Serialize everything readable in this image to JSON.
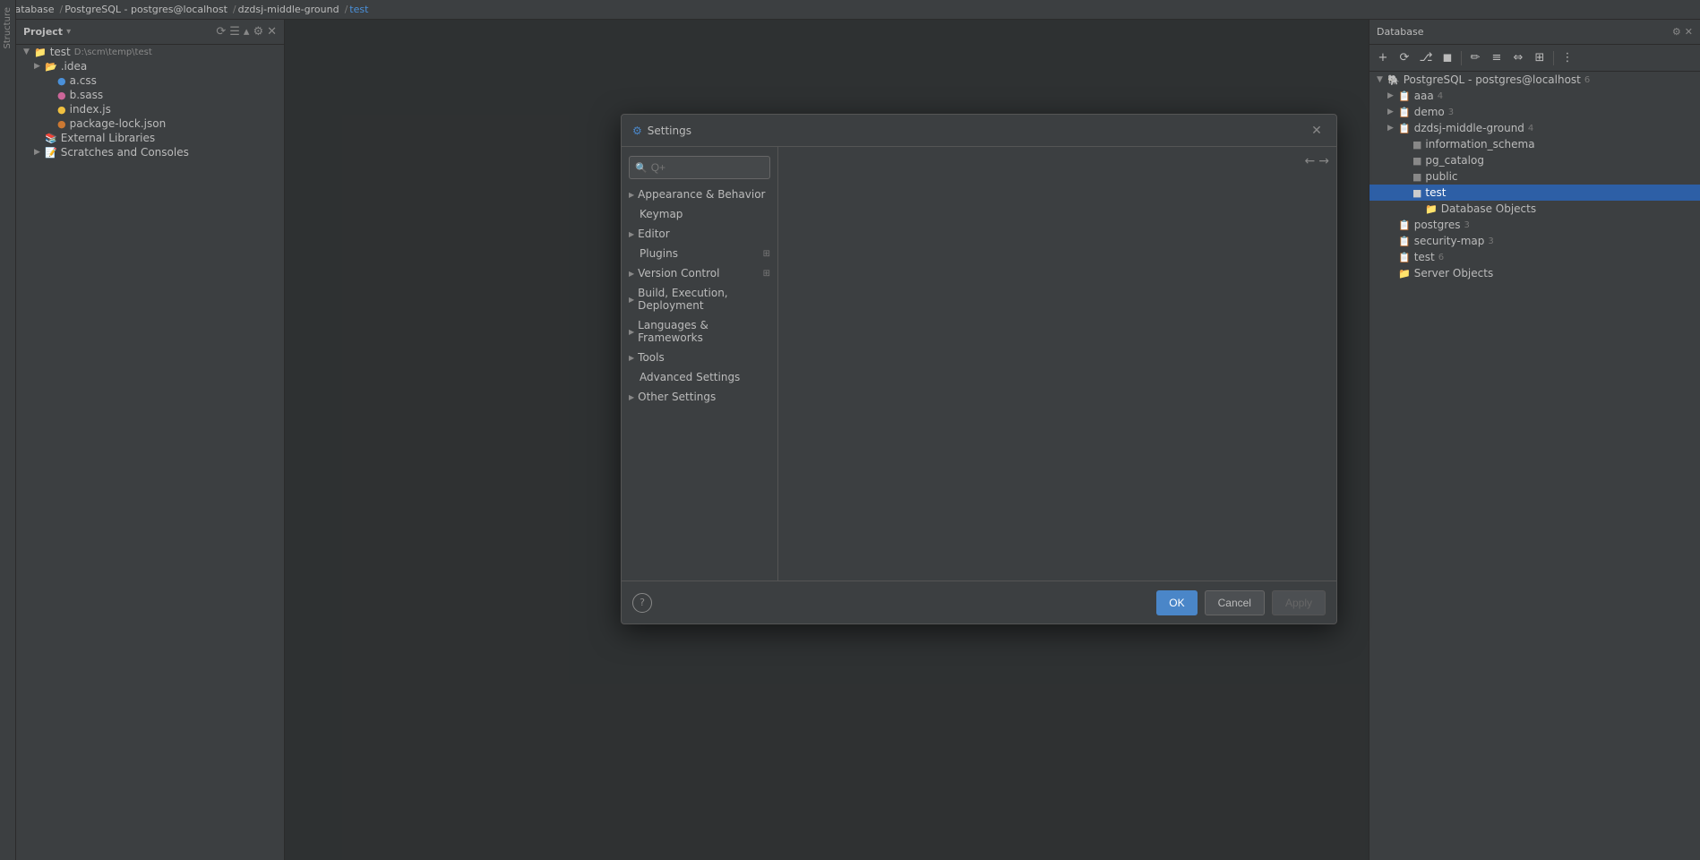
{
  "topbar": {
    "breadcrumbs": [
      "Database",
      "PostgreSQL - postgres@localhost",
      "dzdsj-middle-ground",
      "test"
    ],
    "separator": "/"
  },
  "project_panel": {
    "title": "Project",
    "root_item": "test",
    "root_path": "D:\\scm\\temp\\test",
    "items": [
      {
        "label": ".idea",
        "indent": 1,
        "type": "folder",
        "arrow": true
      },
      {
        "label": "a.css",
        "indent": 2,
        "type": "css"
      },
      {
        "label": "b.sass",
        "indent": 2,
        "type": "sass"
      },
      {
        "label": "index.js",
        "indent": 2,
        "type": "js"
      },
      {
        "label": "package-lock.json",
        "indent": 2,
        "type": "json"
      },
      {
        "label": "External Libraries",
        "indent": 1,
        "type": "folder",
        "arrow": false
      },
      {
        "label": "Scratches and Consoles",
        "indent": 1,
        "type": "folder",
        "arrow": true
      }
    ]
  },
  "database_panel": {
    "title": "Database",
    "items": [
      {
        "label": "PostgreSQL - postgres@localhost",
        "badge": "6",
        "indent": 0,
        "arrow": "▼",
        "type": "db"
      },
      {
        "label": "aaa",
        "badge": "4",
        "indent": 1,
        "arrow": "▶",
        "type": "schema"
      },
      {
        "label": "demo",
        "badge": "3",
        "indent": 1,
        "arrow": "▶",
        "type": "schema"
      },
      {
        "label": "dzdsj-middle-ground",
        "badge": "4",
        "indent": 1,
        "arrow": "▶",
        "type": "schema"
      },
      {
        "label": "information_schema",
        "badge": "",
        "indent": 2,
        "arrow": "",
        "type": "schema_item"
      },
      {
        "label": "pg_catalog",
        "badge": "",
        "indent": 2,
        "arrow": "",
        "type": "schema_item"
      },
      {
        "label": "public",
        "badge": "",
        "indent": 2,
        "arrow": "",
        "type": "schema_item"
      },
      {
        "label": "test",
        "badge": "",
        "indent": 2,
        "arrow": "",
        "type": "schema_item",
        "selected": true
      },
      {
        "label": "Database Objects",
        "badge": "",
        "indent": 3,
        "arrow": "",
        "type": "folder"
      },
      {
        "label": "postgres",
        "badge": "3",
        "indent": 1,
        "arrow": "",
        "type": "schema"
      },
      {
        "label": "security-map",
        "badge": "3",
        "indent": 1,
        "arrow": "",
        "type": "schema"
      },
      {
        "label": "test",
        "badge": "6",
        "indent": 1,
        "arrow": "",
        "type": "schema"
      },
      {
        "label": "Server Objects",
        "badge": "",
        "indent": 1,
        "arrow": "",
        "type": "folder"
      }
    ]
  },
  "settings_dialog": {
    "title": "Settings",
    "search_placeholder": "Q+",
    "nav_items": [
      {
        "label": "Appearance & Behavior",
        "expandable": true,
        "badge": ""
      },
      {
        "label": "Keymap",
        "expandable": false,
        "badge": ""
      },
      {
        "label": "Editor",
        "expandable": true,
        "badge": ""
      },
      {
        "label": "Plugins",
        "expandable": false,
        "badge": "⊞"
      },
      {
        "label": "Version Control",
        "expandable": true,
        "badge": "⊞"
      },
      {
        "label": "Build, Execution, Deployment",
        "expandable": true,
        "badge": ""
      },
      {
        "label": "Languages & Frameworks",
        "expandable": true,
        "badge": ""
      },
      {
        "label": "Tools",
        "expandable": true,
        "badge": ""
      },
      {
        "label": "Advanced Settings",
        "expandable": false,
        "badge": ""
      },
      {
        "label": "Other Settings",
        "expandable": true,
        "badge": ""
      }
    ],
    "footer": {
      "ok_label": "OK",
      "cancel_label": "Cancel",
      "apply_label": "Apply",
      "help_label": "?"
    }
  }
}
